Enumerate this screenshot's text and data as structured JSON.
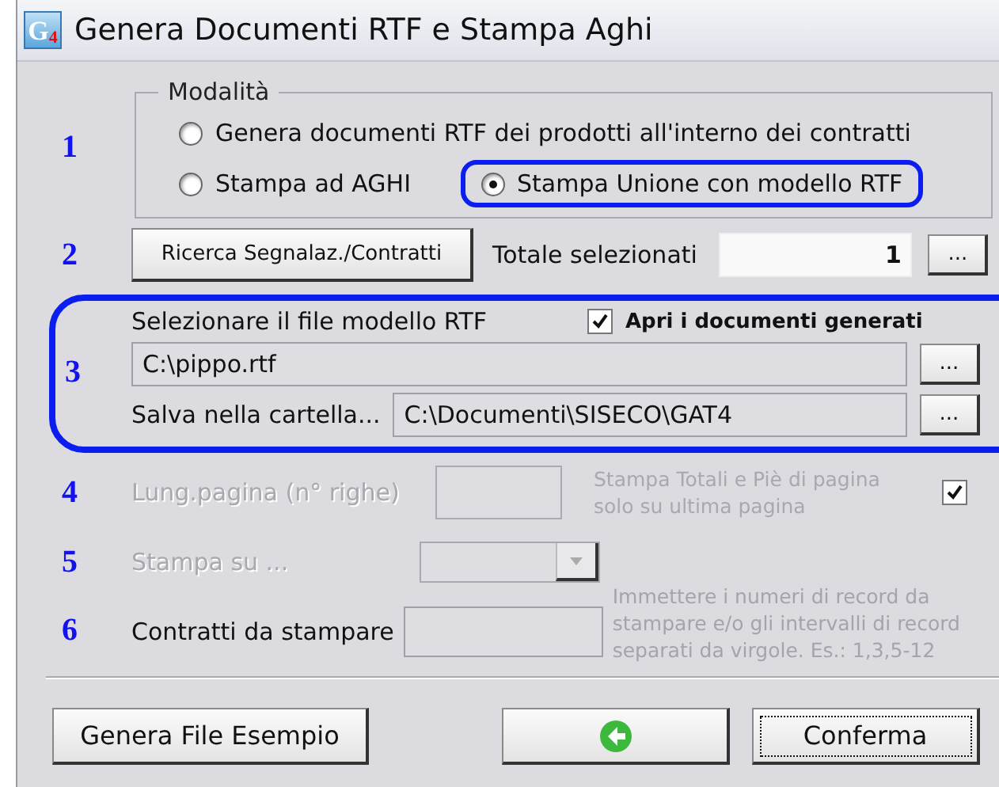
{
  "window": {
    "title": "Genera Documenti RTF e Stampa Aghi",
    "icon": {
      "letter": "G",
      "digit": "4"
    }
  },
  "modalita": {
    "number": "1",
    "legend": "Modalità",
    "options": [
      {
        "label": "Genera documenti RTF dei prodotti all'interno dei contratti",
        "selected": false,
        "highlighted": false
      },
      {
        "label": "Stampa ad AGHI",
        "selected": false,
        "highlighted": false
      },
      {
        "label": "Stampa Unione con modello RTF",
        "selected": true,
        "highlighted": true
      }
    ]
  },
  "search": {
    "number": "2",
    "button": "Ricerca Segnalaz./Contratti",
    "total_label": "Totale selezionati",
    "total_value": "1",
    "browse": "..."
  },
  "template": {
    "number": "3",
    "highlighted": true,
    "label": "Selezionare il file modello RTF",
    "open_docs": {
      "label": "Apri i documenti generati",
      "checked": true
    },
    "file": "C:\\pippo.rtf",
    "file_browse": "...",
    "folder_label": "Salva nella cartella...",
    "folder": "C:\\Documenti\\SISECO\\GAT4",
    "folder_browse": "..."
  },
  "page_length": {
    "number": "4",
    "disabled": true,
    "label": "Lung.pagina (n° righe)",
    "totals_note": "Stampa Totali e Piè di pagina solo su ultima pagina",
    "totals_checked": true
  },
  "print_to": {
    "number": "5",
    "disabled": true,
    "label": "Stampa su ..."
  },
  "contracts": {
    "number": "6",
    "disabled": false,
    "label": "Contratti da stampare",
    "hint": "Immettere i numeri di record da stampare e/o gli intervalli di record separati da virgole. Es.: 1,3,5-12"
  },
  "buttons": [
    {
      "kind": "text",
      "label": "Genera File Esempio",
      "focused": false
    },
    {
      "kind": "back",
      "focused": false
    },
    {
      "kind": "text",
      "label": "Conferma",
      "focused": true
    }
  ]
}
